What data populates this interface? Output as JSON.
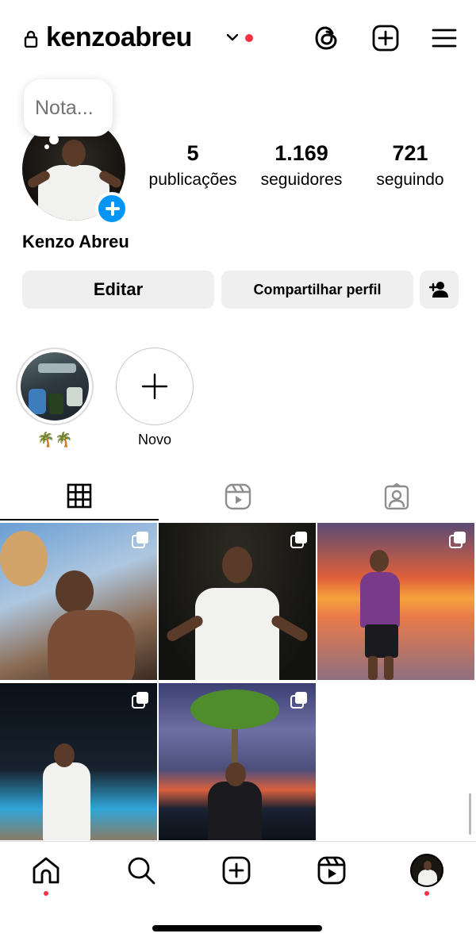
{
  "colors": {
    "notification_dot": "#ff3040",
    "accent_blue": "#0095f6",
    "button_bg": "#efefef"
  },
  "header": {
    "username": "kenzoabreu",
    "lock_icon": "lock-icon",
    "chevron_icon": "chevron-down-icon",
    "threads_icon": "threads-icon",
    "create_icon": "add-square-icon",
    "menu_icon": "hamburger-menu-icon"
  },
  "profile": {
    "note_placeholder": "Nota...",
    "stats": [
      {
        "value": "5",
        "label": "publicações"
      },
      {
        "value": "1.169",
        "label": "seguidores"
      },
      {
        "value": "721",
        "label": "seguindo"
      }
    ],
    "full_name": "Kenzo Abreu",
    "buttons": {
      "edit": "Editar",
      "share": "Compartilhar perfil"
    }
  },
  "highlights": [
    {
      "label": "🌴🌴"
    },
    {
      "label": "Novo"
    }
  ],
  "tabs": [
    {
      "name": "posts-grid",
      "icon": "grid-icon",
      "active": true
    },
    {
      "name": "reels",
      "icon": "reels-icon",
      "active": false
    },
    {
      "name": "tagged",
      "icon": "tagged-user-icon",
      "active": false
    }
  ],
  "posts": [
    {
      "multi": true
    },
    {
      "multi": true
    },
    {
      "multi": true
    },
    {
      "multi": true
    },
    {
      "multi": true
    }
  ],
  "bottom_nav": [
    {
      "name": "home",
      "icon": "home-icon",
      "badge": true
    },
    {
      "name": "search",
      "icon": "search-icon",
      "badge": false
    },
    {
      "name": "create",
      "icon": "add-square-icon",
      "badge": false
    },
    {
      "name": "reels",
      "icon": "reels-icon",
      "badge": false
    },
    {
      "name": "profile",
      "icon": "profile-avatar",
      "badge": true
    }
  ]
}
